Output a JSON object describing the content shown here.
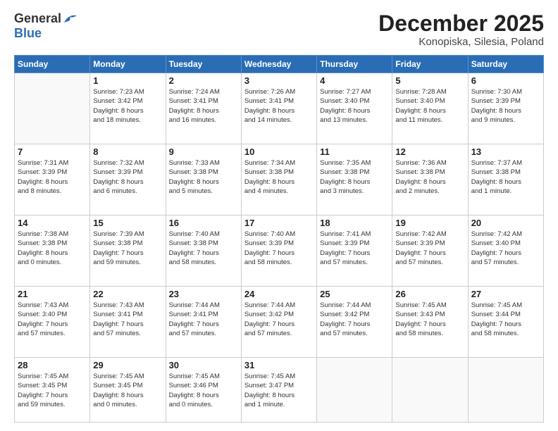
{
  "logo": {
    "general": "General",
    "blue": "Blue"
  },
  "header": {
    "month_year": "December 2025",
    "location": "Konopiska, Silesia, Poland"
  },
  "days_of_week": [
    "Sunday",
    "Monday",
    "Tuesday",
    "Wednesday",
    "Thursday",
    "Friday",
    "Saturday"
  ],
  "weeks": [
    [
      {
        "day": "",
        "info": ""
      },
      {
        "day": "1",
        "info": "Sunrise: 7:23 AM\nSunset: 3:42 PM\nDaylight: 8 hours\nand 18 minutes."
      },
      {
        "day": "2",
        "info": "Sunrise: 7:24 AM\nSunset: 3:41 PM\nDaylight: 8 hours\nand 16 minutes."
      },
      {
        "day": "3",
        "info": "Sunrise: 7:26 AM\nSunset: 3:41 PM\nDaylight: 8 hours\nand 14 minutes."
      },
      {
        "day": "4",
        "info": "Sunrise: 7:27 AM\nSunset: 3:40 PM\nDaylight: 8 hours\nand 13 minutes."
      },
      {
        "day": "5",
        "info": "Sunrise: 7:28 AM\nSunset: 3:40 PM\nDaylight: 8 hours\nand 11 minutes."
      },
      {
        "day": "6",
        "info": "Sunrise: 7:30 AM\nSunset: 3:39 PM\nDaylight: 8 hours\nand 9 minutes."
      }
    ],
    [
      {
        "day": "7",
        "info": "Sunrise: 7:31 AM\nSunset: 3:39 PM\nDaylight: 8 hours\nand 8 minutes."
      },
      {
        "day": "8",
        "info": "Sunrise: 7:32 AM\nSunset: 3:39 PM\nDaylight: 8 hours\nand 6 minutes."
      },
      {
        "day": "9",
        "info": "Sunrise: 7:33 AM\nSunset: 3:38 PM\nDaylight: 8 hours\nand 5 minutes."
      },
      {
        "day": "10",
        "info": "Sunrise: 7:34 AM\nSunset: 3:38 PM\nDaylight: 8 hours\nand 4 minutes."
      },
      {
        "day": "11",
        "info": "Sunrise: 7:35 AM\nSunset: 3:38 PM\nDaylight: 8 hours\nand 3 minutes."
      },
      {
        "day": "12",
        "info": "Sunrise: 7:36 AM\nSunset: 3:38 PM\nDaylight: 8 hours\nand 2 minutes."
      },
      {
        "day": "13",
        "info": "Sunrise: 7:37 AM\nSunset: 3:38 PM\nDaylight: 8 hours\nand 1 minute."
      }
    ],
    [
      {
        "day": "14",
        "info": "Sunrise: 7:38 AM\nSunset: 3:38 PM\nDaylight: 8 hours\nand 0 minutes."
      },
      {
        "day": "15",
        "info": "Sunrise: 7:39 AM\nSunset: 3:38 PM\nDaylight: 7 hours\nand 59 minutes."
      },
      {
        "day": "16",
        "info": "Sunrise: 7:40 AM\nSunset: 3:38 PM\nDaylight: 7 hours\nand 58 minutes."
      },
      {
        "day": "17",
        "info": "Sunrise: 7:40 AM\nSunset: 3:39 PM\nDaylight: 7 hours\nand 58 minutes."
      },
      {
        "day": "18",
        "info": "Sunrise: 7:41 AM\nSunset: 3:39 PM\nDaylight: 7 hours\nand 57 minutes."
      },
      {
        "day": "19",
        "info": "Sunrise: 7:42 AM\nSunset: 3:39 PM\nDaylight: 7 hours\nand 57 minutes."
      },
      {
        "day": "20",
        "info": "Sunrise: 7:42 AM\nSunset: 3:40 PM\nDaylight: 7 hours\nand 57 minutes."
      }
    ],
    [
      {
        "day": "21",
        "info": "Sunrise: 7:43 AM\nSunset: 3:40 PM\nDaylight: 7 hours\nand 57 minutes."
      },
      {
        "day": "22",
        "info": "Sunrise: 7:43 AM\nSunset: 3:41 PM\nDaylight: 7 hours\nand 57 minutes."
      },
      {
        "day": "23",
        "info": "Sunrise: 7:44 AM\nSunset: 3:41 PM\nDaylight: 7 hours\nand 57 minutes."
      },
      {
        "day": "24",
        "info": "Sunrise: 7:44 AM\nSunset: 3:42 PM\nDaylight: 7 hours\nand 57 minutes."
      },
      {
        "day": "25",
        "info": "Sunrise: 7:44 AM\nSunset: 3:42 PM\nDaylight: 7 hours\nand 57 minutes."
      },
      {
        "day": "26",
        "info": "Sunrise: 7:45 AM\nSunset: 3:43 PM\nDaylight: 7 hours\nand 58 minutes."
      },
      {
        "day": "27",
        "info": "Sunrise: 7:45 AM\nSunset: 3:44 PM\nDaylight: 7 hours\nand 58 minutes."
      }
    ],
    [
      {
        "day": "28",
        "info": "Sunrise: 7:45 AM\nSunset: 3:45 PM\nDaylight: 7 hours\nand 59 minutes."
      },
      {
        "day": "29",
        "info": "Sunrise: 7:45 AM\nSunset: 3:45 PM\nDaylight: 8 hours\nand 0 minutes."
      },
      {
        "day": "30",
        "info": "Sunrise: 7:45 AM\nSunset: 3:46 PM\nDaylight: 8 hours\nand 0 minutes."
      },
      {
        "day": "31",
        "info": "Sunrise: 7:45 AM\nSunset: 3:47 PM\nDaylight: 8 hours\nand 1 minute."
      },
      {
        "day": "",
        "info": ""
      },
      {
        "day": "",
        "info": ""
      },
      {
        "day": "",
        "info": ""
      }
    ]
  ]
}
